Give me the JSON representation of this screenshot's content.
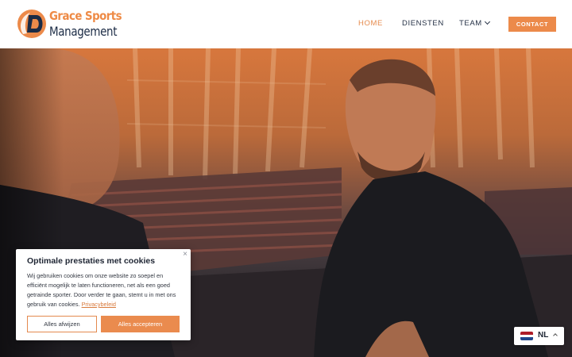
{
  "brand": {
    "name_line1": "Grace Sports",
    "name_line2": "Management",
    "logo_icon": "gsm-logo-mark",
    "accent_color": "#ec8a4a",
    "navy_color": "#1b2b45"
  },
  "nav": {
    "items": [
      {
        "label": "HOME",
        "active": true
      },
      {
        "label": "DIENSTEN",
        "active": false
      },
      {
        "label": "TEAM",
        "active": false,
        "dropdown": true
      }
    ],
    "contact_label": "CONTACT"
  },
  "hero": {
    "image": "two athletes talking in a stadium at sunset"
  },
  "cookie_banner": {
    "title": "Optimale prestaties met cookies",
    "body": "Wij gebruiken cookies om onze website zo soepel en efficiënt mogelijk te laten functioneren, net als een goed getrainde sporter. Door verder te gaan, stemt u in met ons gebruik van cookies.",
    "link_label": "Privacybeleid",
    "close_icon": "close-icon",
    "decline_label": "Alles afwijzen",
    "accept_label": "Alles accepteren"
  },
  "language": {
    "code": "NL",
    "flag_icon": "netherlands-flag-icon",
    "chevron_icon": "chevron-up-icon"
  }
}
